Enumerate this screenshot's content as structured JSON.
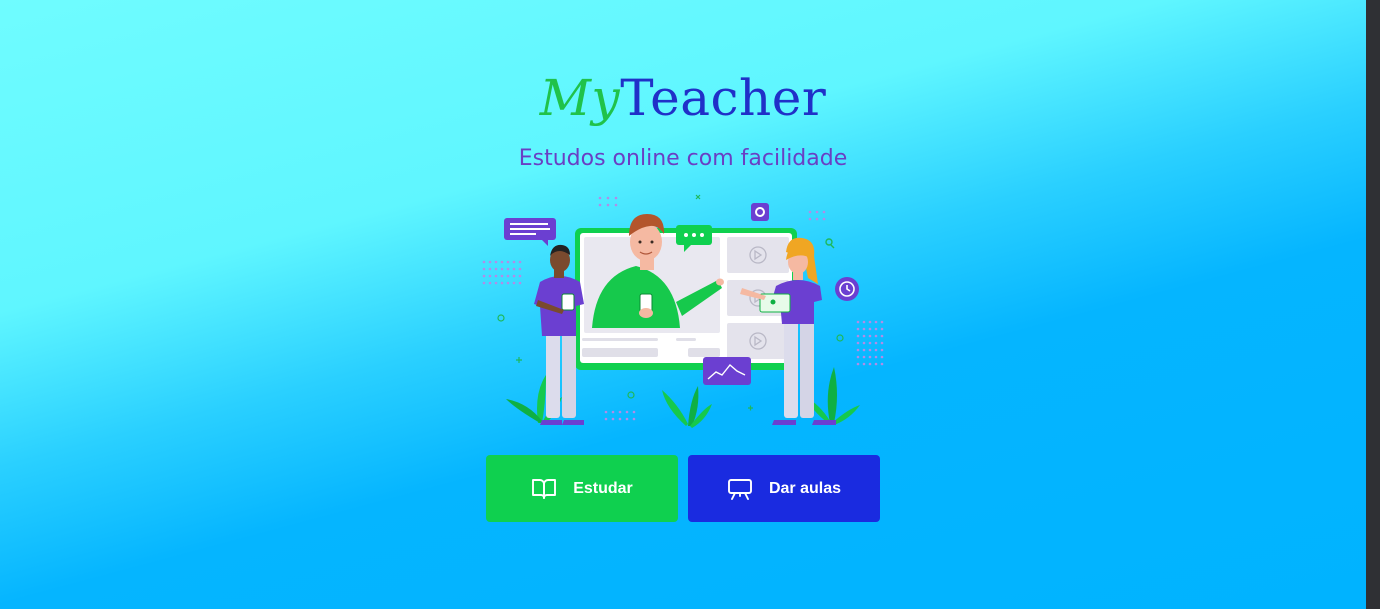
{
  "brand": {
    "part1": "My",
    "part2": "Teacher",
    "colors": {
      "part1": "#20c24a",
      "part2": "#2030c8"
    }
  },
  "tagline": "Estudos online com facilidade",
  "hero": {
    "illustration": "online-teaching-illustration"
  },
  "actions": [
    {
      "label": "Estudar",
      "icon": "book-open-icon",
      "color": "#0fd04f"
    },
    {
      "label": "Dar aulas",
      "icon": "presentation-board-icon",
      "color": "#1a2be0"
    }
  ],
  "theme": {
    "background_top": "#6ffcff",
    "background_bottom": "#00b3ff",
    "tagline_color": "#6a3fc4"
  }
}
